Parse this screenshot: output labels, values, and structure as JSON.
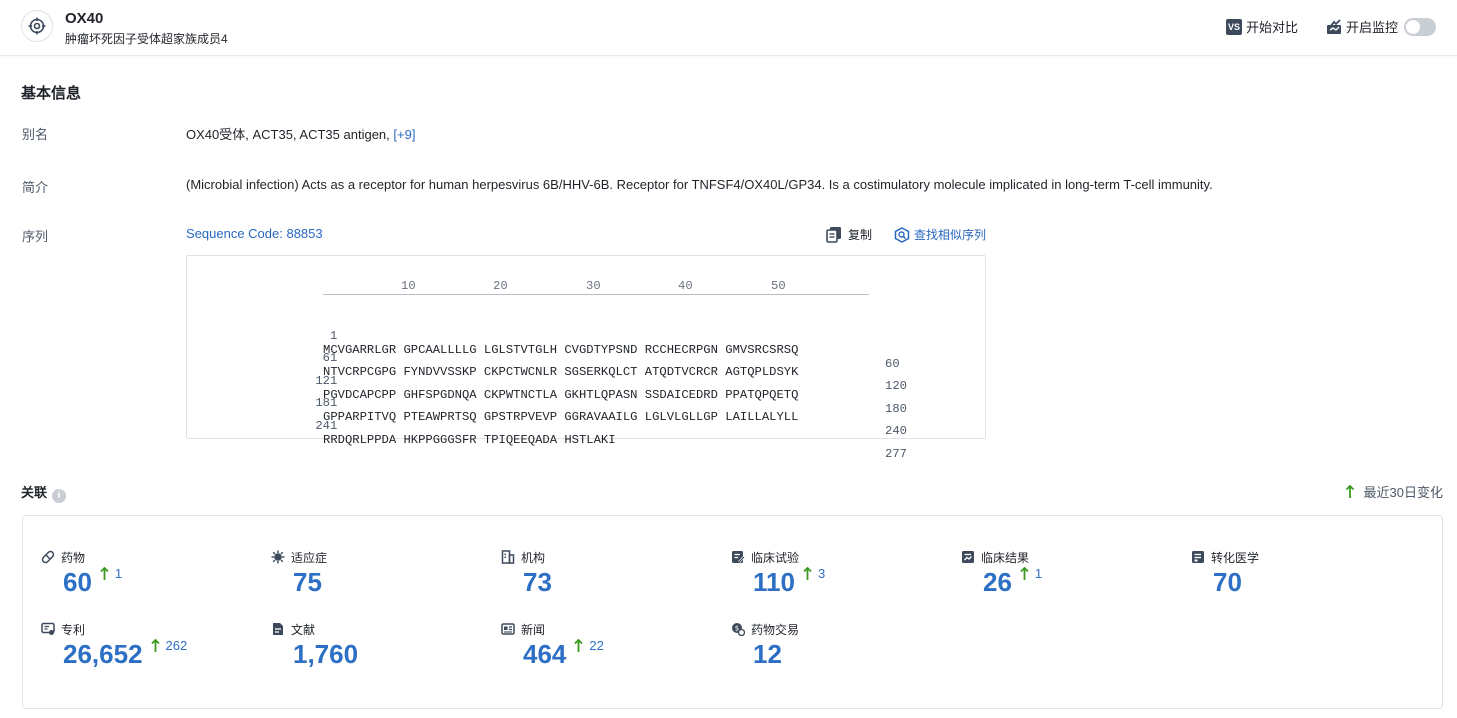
{
  "header": {
    "title": "OX40",
    "subtitle": "肿瘤坏死因子受体超家族成员4",
    "compare_badge": "VS",
    "compare_label": "开始对比",
    "monitor_label": "开启监控"
  },
  "basic_info": {
    "section_title": "基本信息",
    "alias_label": "别名",
    "aliases": "OX40受体,  ACT35,  ACT35 antigen,",
    "alias_more": "[+9]",
    "summary_label": "简介",
    "summary": "(Microbial infection) Acts as a receptor for human herpesvirus 6B/HHV-6B. Receptor for TNFSF4/OX40L/GP34. Is a costimulatory molecule implicated in long-term T-cell immunity.",
    "sequence_label": "序列",
    "sequence_code": "Sequence Code: 88853",
    "copy_label": "复制",
    "find_similar_label": "查找相似序列"
  },
  "sequence": {
    "ruler": [
      "10",
      "20",
      "30",
      "40",
      "50"
    ],
    "rows": [
      {
        "start": "1",
        "text": "MCVGARRLGR GPCAALLLLG LGLSTVTGLH CVGDTYPSND RCCHECRPGN GMVSRCSRSQ",
        "end": "60"
      },
      {
        "start": "61",
        "text": "NTVCRPCGPG FYNDVVSSKP CKPCTWCNLR SGSERKQLCT ATQDTVCRCR AGTQPLDSYK",
        "end": "120"
      },
      {
        "start": "121",
        "text": "PGVDCAPCPP GHFSPGDNQA CKPWTNCTLA GKHTLQPASN SSDAICEDRD PPATQPQETQ",
        "end": "180"
      },
      {
        "start": "181",
        "text": "GPPARPITVQ PTEAWPRTSQ GPSTRPVEVP GGRAVAAILG LGLVLGLLGP LAILLALYLL",
        "end": "240"
      },
      {
        "start": "241",
        "text": "RRDQRLPPDA HKPPGGGSFR TPIQEEQADA HSTLAKI",
        "end": "277"
      }
    ]
  },
  "assoc": {
    "section_title": "关联",
    "info_glyph": "i",
    "legend_label": "最近30日变化",
    "accent_color": "#2d6fc4",
    "up_color": "#3a9a1f",
    "stats": [
      {
        "label": "药物",
        "value": "60",
        "delta": "1",
        "icon": "pill-icon"
      },
      {
        "label": "适应症",
        "value": "75",
        "delta": "",
        "icon": "virus-icon"
      },
      {
        "label": "机构",
        "value": "73",
        "delta": "",
        "icon": "building-icon"
      },
      {
        "label": "临床试验",
        "value": "110",
        "delta": "3",
        "icon": "clinical-trial-icon"
      },
      {
        "label": "临床结果",
        "value": "26",
        "delta": "1",
        "icon": "clinical-result-icon"
      },
      {
        "label": "转化医学",
        "value": "70",
        "delta": "",
        "icon": "translational-icon"
      },
      {
        "label": "专利",
        "value": "26,652",
        "delta": "262",
        "icon": "patent-icon"
      },
      {
        "label": "文献",
        "value": "1,760",
        "delta": "",
        "icon": "document-icon"
      },
      {
        "label": "新闻",
        "value": "464",
        "delta": "22",
        "icon": "news-icon"
      },
      {
        "label": "药物交易",
        "value": "12",
        "delta": "",
        "icon": "deal-icon"
      }
    ]
  }
}
